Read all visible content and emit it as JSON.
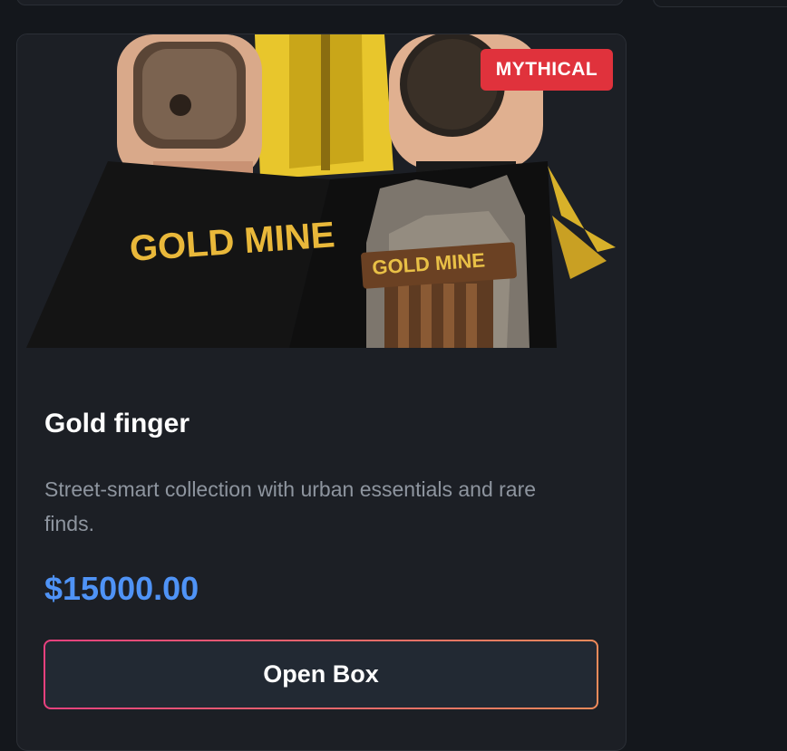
{
  "card": {
    "badge": "MYTHICAL",
    "title": "Gold finger",
    "description": "Street-smart collection with urban essentials and rare finds.",
    "price": "$15000.00",
    "button_label": "Open Box",
    "image_text": {
      "box_label": "GOLD MINE",
      "sign_label": "GOLD MINE"
    }
  },
  "colors": {
    "badge_bg": "#e0323c",
    "price": "#4f93f6",
    "button_gradient_start": "#e8407e",
    "button_gradient_end": "#f08a5a",
    "card_bg": "#1c1f25"
  }
}
